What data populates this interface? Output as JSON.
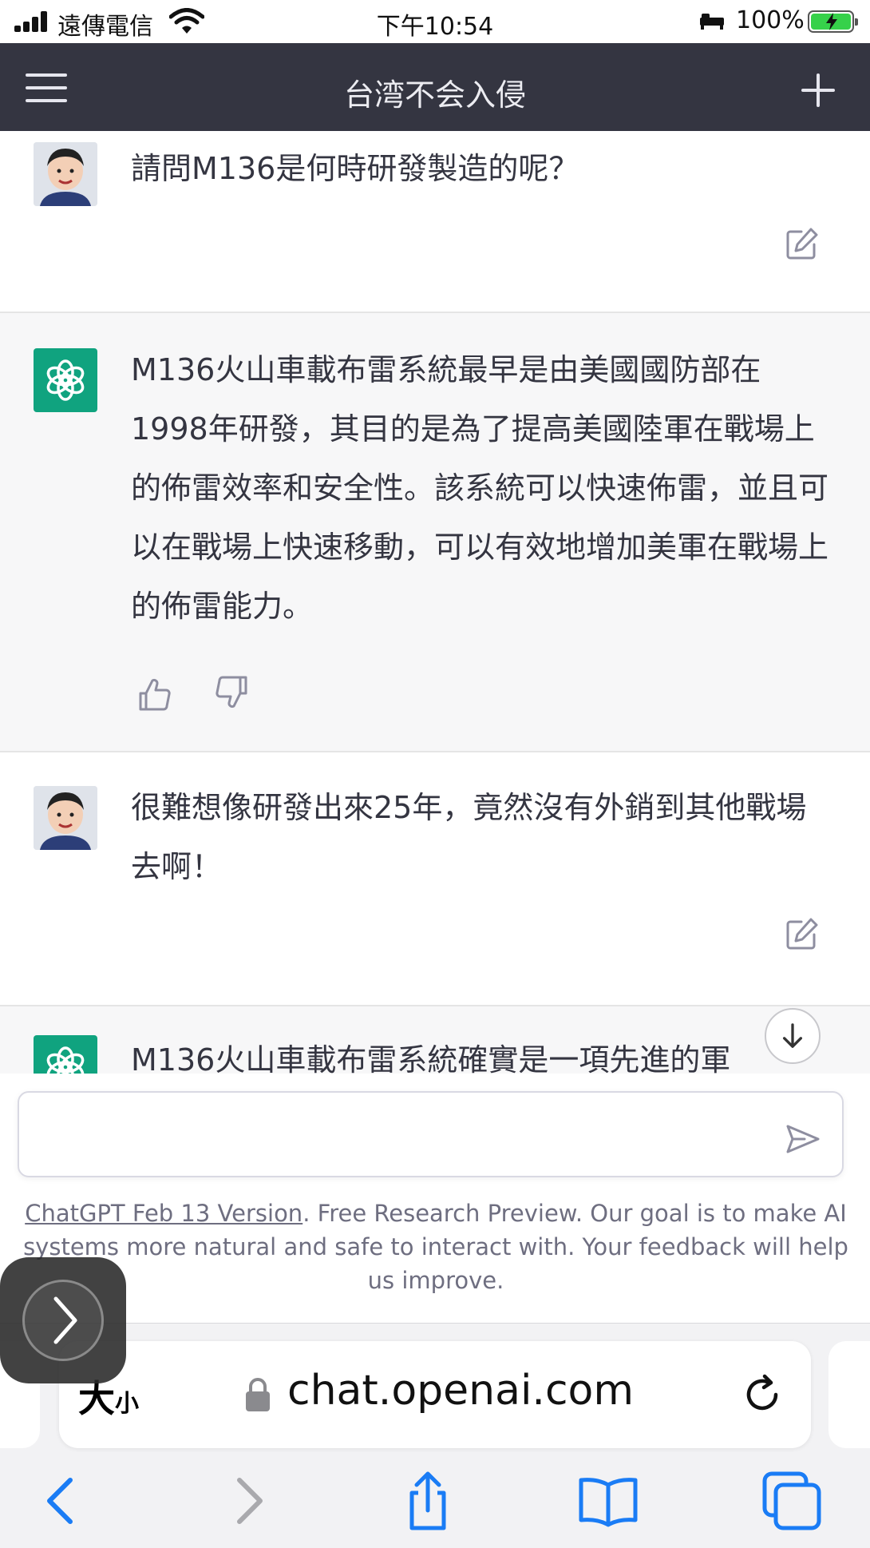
{
  "status_bar": {
    "carrier": "遠傳電信",
    "time": "下午10:54",
    "battery_percent": "100%",
    "battery_color": "#36d14a"
  },
  "header": {
    "title": "台湾不会入侵",
    "menu_icon": "hamburger-menu-icon",
    "new_chat_icon": "plus-icon",
    "background": "#343541"
  },
  "messages": [
    {
      "role": "user",
      "text": "請問M136是何時研發製造的呢？"
    },
    {
      "role": "assistant",
      "text": "M136火山車載布雷系統最早是由美國國防部在1998年研發，其目的是為了提高美國陸軍在戰場上的佈雷效率和安全性。該系統可以快速佈雷，並且可以在戰場上快速移動，可以有效地增加美軍在戰場上的佈雷能力。"
    },
    {
      "role": "user",
      "text": "很難想像研發出來25年，竟然沒有外銷到其他戰場去啊！"
    },
    {
      "role": "assistant",
      "text": "M136火山車載布雷系統確實是一項先進的軍"
    }
  ],
  "composer": {
    "placeholder": "",
    "value": ""
  },
  "footer": {
    "version_link": "ChatGPT Feb 13 Version",
    "note": ". Free Research Preview. Our goal is to make AI systems more natural and safe to interact with. Your feedback will help us improve."
  },
  "safari": {
    "text_size_large": "大",
    "text_size_small": "小",
    "url": "chat.openai.com",
    "accent": "#1a7cf5"
  },
  "colors": {
    "assistant_avatar": "#10a37f",
    "assistant_bg": "#f7f7f8"
  }
}
